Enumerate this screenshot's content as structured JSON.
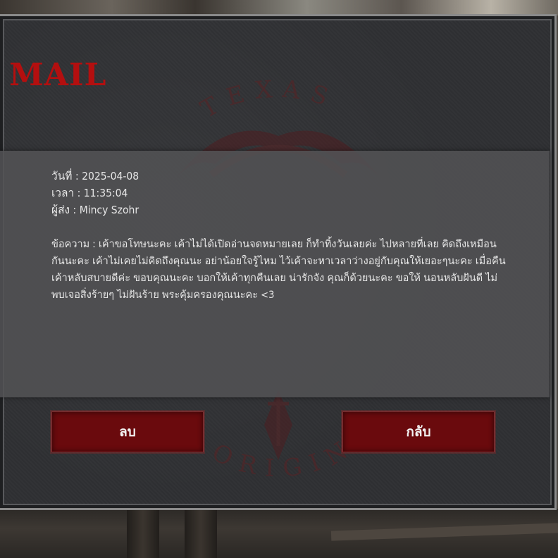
{
  "title": "S MAIL",
  "watermark": {
    "top_text": "TEXAS",
    "bottom_text": "ORIGIN"
  },
  "mail": {
    "date_label": "วันที่ :",
    "date_value": "2025-04-08",
    "time_label": "เวลา :",
    "time_value": "11:35:04",
    "sender_label": "ผู้ส่ง :",
    "sender_value": "Mincy Szohr",
    "message_label": "ข้อความ :",
    "message_lines": [
      "เค้าขอโทษนะคะ เค้าไม่ได้เปิดอ่านจดหมายเลย ก็ทำทิ้งวันเลยค่ะ ไปหลายที่เลย คิดถึงเหมือน",
      "กันนะคะ เค้าไม่เคยไม่คิดถึงคุณนะ อย่าน้อยใจรู้ไหม ไว้เค้าจะหาเวลาว่างอยู่กับคุณให้เยอะๆนะคะ เมื่อคืน",
      "เค้าหลับสบายดีค่ะ ขอบคุณนะคะ บอกให้เค้าทุกคืนเลย น่ารักจัง คุณก็ด้วยนะคะ ขอให้ นอนหลับฝันดี ไม่",
      "พบเจอสิ่งร้ายๆ ไม่ฝันร้าย พระคุ้มครองคุณนะคะ <3"
    ]
  },
  "buttons": {
    "delete_label": "ลบ",
    "back_label": "กลับ"
  },
  "colors": {
    "title": "#b40f0f",
    "button_bg": "#6a0a0d",
    "panel_bg": "#2f3033",
    "content_bg": "#525254"
  }
}
